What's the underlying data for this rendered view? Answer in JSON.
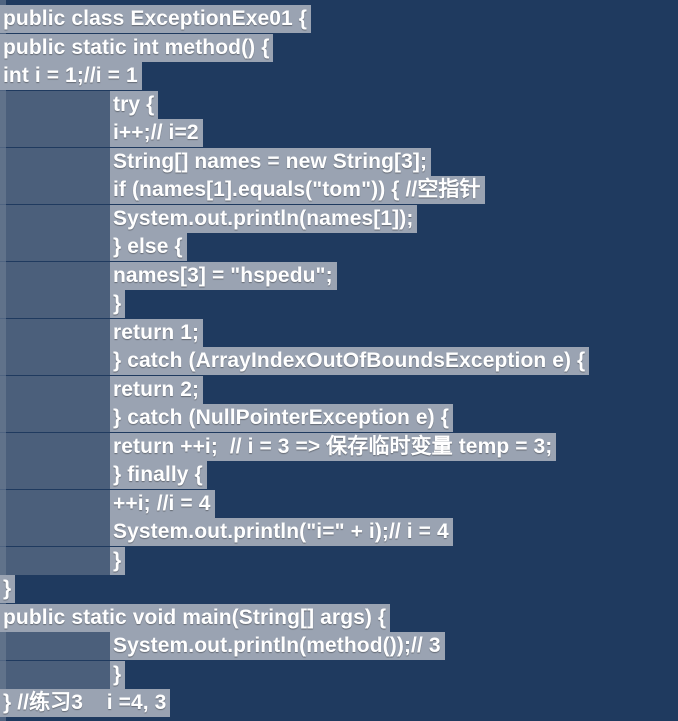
{
  "code": {
    "lines": [
      "public class ExceptionExe01 {",
      "public static int method() {",
      "int i = 1;//i = 1",
      "try {",
      "i++;// i=2",
      "String[] names = new String[3];",
      "if (names[1].equals(\"tom\")) { //空指针",
      "System.out.println(names[1]);",
      "} else {",
      "names[3] = \"hspedu\";",
      "}",
      "return 1;",
      "} catch (ArrayIndexOutOfBoundsException e) {",
      "return 2;",
      "} catch (NullPointerException e) {",
      "return ++i;  // i = 3 => 保存临时变量 temp = 3;",
      "} finally {",
      "++i; //i = 4",
      "System.out.println(\"i=\" + i);// i = 4",
      "}",
      "}",
      "public static void main(String[] args) {",
      "System.out.println(method());// 3",
      "}",
      "} //练习3    i =4, 3"
    ]
  }
}
